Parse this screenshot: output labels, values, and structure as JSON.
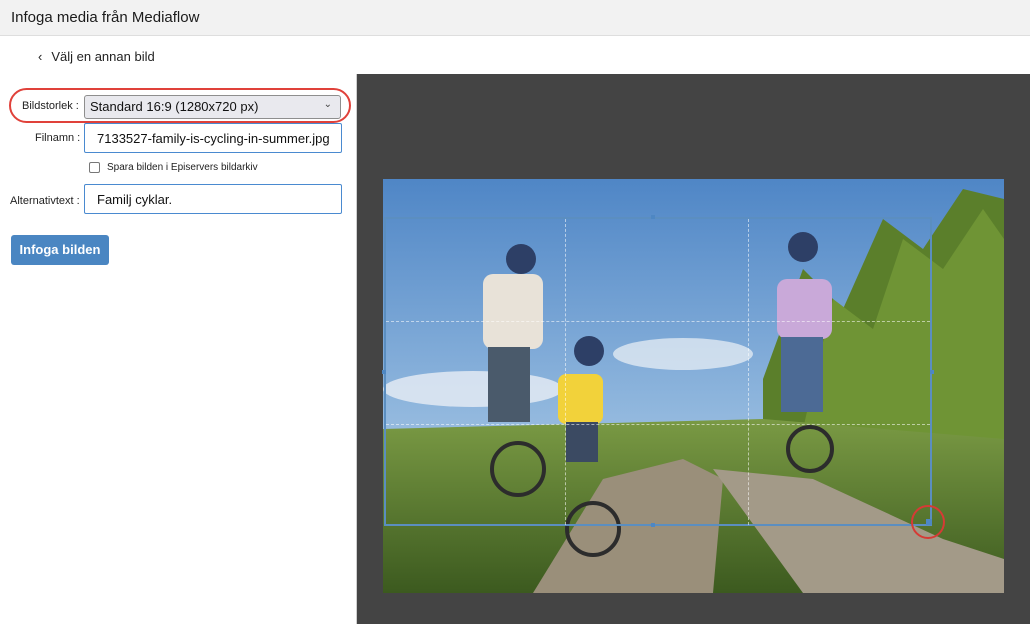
{
  "dialog": {
    "title": "Infoga media från Mediaflow"
  },
  "nav": {
    "back_label": "Välj en annan bild",
    "back_icon": "chevron-left-icon"
  },
  "form": {
    "size_label": "Bildstorlek :",
    "size_value": "Standard 16:9 (1280x720 px)",
    "filename_label": "Filnamn :",
    "filename_value": "7133527-family-is-cycling-in-summer.jpg",
    "save_label": "Spara bilden i Episervers bildarkiv",
    "save_checked": false,
    "alt_label": "Alternativtext :",
    "alt_value": "Familj cyklar.",
    "insert_label": "Infoga bilden"
  },
  "colors": {
    "accent": "#4a86c2",
    "highlight": "#e0413a",
    "stage_bg": "#444444"
  }
}
